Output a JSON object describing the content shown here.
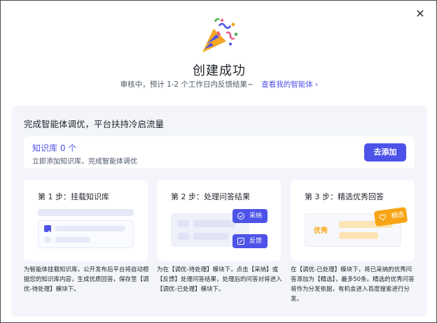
{
  "dialog": {
    "close_glyph": "✕",
    "title": "创建成功",
    "status_text": "审核中，预计 1-2 个工作日内反馈结果~",
    "view_link": "查看我的智能体",
    "view_link_chevron": "›"
  },
  "panel": {
    "title": "完成智能体调优，平台扶持冷启流量",
    "knowledge": {
      "title": "知识库 0 个",
      "desc": "立即添加知识库，完成智能体调优",
      "button": "去添加"
    },
    "steps": [
      {
        "title": "第 1 步：挂载知识库",
        "desc": "为智能体挂载知识库，公开发布后平台将自动根据您的知识库内容，生成优质回答，保存至【调优-待处理】模块下。"
      },
      {
        "title": "第 2 步：处理问答结果",
        "desc": "为在【调优-待处理】模块下，点击【采纳】或【反馈】处理问答结果，处理后的问答对将进入【调优-已处理】模块下。",
        "accept_label": "采纳",
        "feedback_label": "反馈"
      },
      {
        "title": "第 3 步：精选优秀回答",
        "desc": "在【调优-已处理】模块下，将已采纳的优秀问答添加为【精选】，最多50条。精选的优秀问答将作为分发依据，有机会进入百度搜索进行分发。",
        "excellent_label": "优秀",
        "featured_label": "精选"
      }
    ]
  },
  "colors": {
    "accent": "#4d53e8",
    "orange": "#f7a516",
    "panel_bg": "#f3f5fa"
  },
  "icons": [
    "close-icon",
    "party-popper-icon",
    "chevron-right-icon",
    "checkbox-checked-icon",
    "accept-icon",
    "feedback-icon",
    "heart-tag-icon"
  ]
}
